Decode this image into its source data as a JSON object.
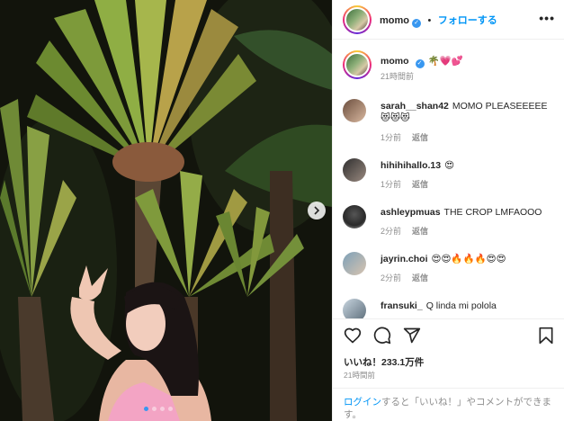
{
  "post": {
    "username": "momo",
    "follow_label": "フォローする",
    "separator": "•",
    "more_label": "•••"
  },
  "caption": {
    "username": "momo",
    "text": "🌴💗💕",
    "time": "21時間前"
  },
  "comments": [
    {
      "username": "sarah__shan42",
      "text": "MOMO PLEASEEEEE 😻😻😻",
      "time": "1分前",
      "reply": "返信"
    },
    {
      "username": "hihihihallo.13",
      "text": "😍",
      "time": "1分前",
      "reply": "返信"
    },
    {
      "username": "ashleypmuas",
      "text": "THE CROP LMFAOOO",
      "time": "2分前",
      "reply": "返信"
    },
    {
      "username": "jayrin.choi",
      "text": "😍😍🔥🔥🔥😍😍",
      "time": "2分前",
      "reply": "返信"
    },
    {
      "username": "fransuki_",
      "text": "Q linda mi polola",
      "time": "",
      "reply": ""
    }
  ],
  "engagement": {
    "likes": "いいね！233.1万件",
    "time": "21時間前"
  },
  "login_prompt": {
    "login_link": "ログイン",
    "rest": "すると「いいね！」やコメントができます。"
  },
  "icons": {
    "verified": "verified-badge-icon",
    "like": "heart-icon",
    "comment": "comment-icon",
    "share": "paper-plane-icon",
    "save": "bookmark-icon",
    "next": "chevron-right-icon"
  },
  "colors": {
    "accent": "#0095f6",
    "verified": "#3897f0",
    "muted": "#8e8e8e"
  }
}
